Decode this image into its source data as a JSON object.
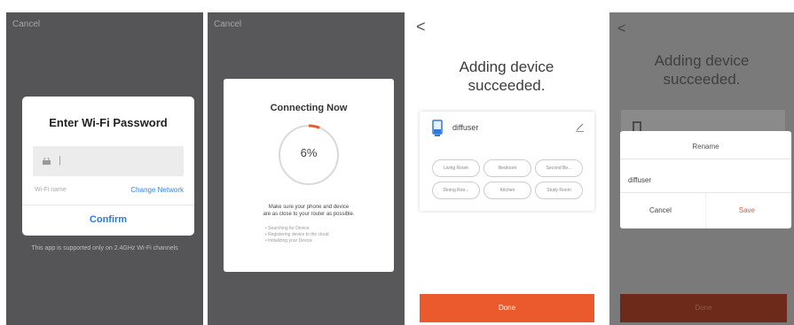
{
  "screen1": {
    "cancel": "Cancel",
    "title": "Enter Wi-Fi Password",
    "field_cursor": "|",
    "wifi_name": "Wi-Fi name",
    "change_network": "Change Network",
    "confirm": "Confirm",
    "note": "This app is supported only on 2.4GHz Wi-Fi channels"
  },
  "screen2": {
    "cancel": "Cancel",
    "title": "Connecting Now",
    "progress": 0.06,
    "progress_label": "6%",
    "desc_line1": "Make sure your phone and device",
    "desc_line2": "are as close to your router as possible.",
    "steps": [
      "Searching for Device",
      "Registering device to the cloud",
      "Initializing your Device"
    ]
  },
  "screen3": {
    "back": "<",
    "title_line1": "Adding device",
    "title_line2": "succeeded.",
    "device_name": "diffuser",
    "rooms": [
      "Living Room",
      "Bedroom",
      "Second Be...",
      "Dining Roo...",
      "Kitchen",
      "Study Room"
    ],
    "done": "Done"
  },
  "screen4": {
    "back": "<",
    "title_line1": "Adding device",
    "title_line2": "succeeded.",
    "dialog_title": "Rename",
    "input_value": "diffuser",
    "cancel": "Cancel",
    "save": "Save",
    "done": "Done"
  },
  "colors": {
    "accent": "#ea5a2c",
    "link": "#3a84d8",
    "progress_arc": "#ea5a2c",
    "overlay": "#555557"
  }
}
